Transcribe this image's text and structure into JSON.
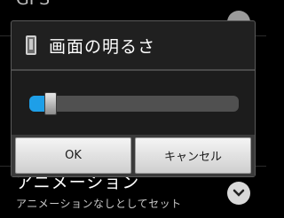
{
  "background": {
    "top_item_label": "GPS",
    "item_title": "アニメーション",
    "item_subtitle": "アニメーションなしとしてセット",
    "chevron_icon": "chevron-down-icon"
  },
  "dialog": {
    "title": "画面の明るさ",
    "icon": "phone-icon",
    "slider": {
      "value_fraction": 0.07,
      "accent_color": "#1e9fe8"
    },
    "buttons": {
      "ok_label": "OK",
      "cancel_label": "キャンセル"
    }
  }
}
